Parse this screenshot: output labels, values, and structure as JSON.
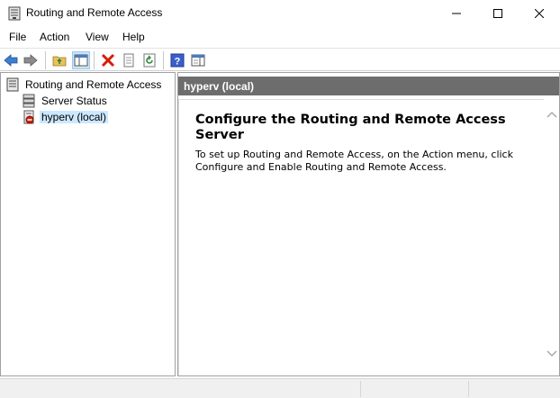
{
  "window": {
    "title": "Routing and Remote Access",
    "app_icon": "rras-server-icon"
  },
  "menu": {
    "items": [
      "File",
      "Action",
      "View",
      "Help"
    ]
  },
  "toolbar": {
    "buttons": [
      {
        "name": "back-icon"
      },
      {
        "name": "forward-icon"
      },
      {
        "name": "up-folder-icon"
      },
      {
        "name": "show-hide-console-tree-icon",
        "pressed": true
      },
      {
        "name": "delete-icon"
      },
      {
        "name": "properties-icon"
      },
      {
        "name": "refresh-icon"
      },
      {
        "name": "help-icon"
      },
      {
        "name": "show-hide-action-pane-icon"
      }
    ]
  },
  "tree": {
    "root": {
      "label": "Routing and Remote Access",
      "icon": "rras-root-icon"
    },
    "children": [
      {
        "label": "Server Status",
        "icon": "server-status-icon"
      },
      {
        "label": "hyperv (local)",
        "icon": "server-stopped-icon",
        "selected": true
      }
    ]
  },
  "details": {
    "header": "hyperv (local)",
    "title": "Configure the Routing and Remote Access Server",
    "body": "To set up Routing and Remote Access, on the Action menu, click Configure and Enable Routing and Remote Access."
  },
  "colors": {
    "header_bg": "#6d6d6d",
    "selection_bg": "#cce8ff",
    "delete_red": "#d81e06",
    "help_blue": "#3a5fcd"
  }
}
